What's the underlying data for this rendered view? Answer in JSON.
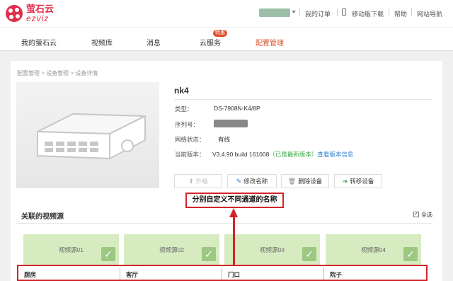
{
  "brand": {
    "name": "萤石云",
    "sub": "ezviz",
    "color": "#e02e4c"
  },
  "topnav": {
    "orders": "我的订单",
    "mobile": "移动版下载",
    "help": "帮助",
    "sitemap": "网站导航"
  },
  "nav": {
    "items": [
      "我的萤石云",
      "视频库",
      "消息",
      "云服务",
      "配置管理"
    ],
    "active_index": 4,
    "badge": "特惠"
  },
  "breadcrumb": "配置管理 > 设备管理 > 设备详情",
  "device": {
    "name": "nk4",
    "type_label": "类型：",
    "type_value": "DS-7908N-K4/8P",
    "serial_label": "序列号：",
    "network_label": "网络状态：",
    "network_value": "有线",
    "version_label": "当前版本：",
    "version_value": "V3.4.90 build 161008",
    "version_status": "（已是最新版本）",
    "version_link": "查看版本信息"
  },
  "buttons": {
    "upgrade": "升级",
    "rename": "修改名称",
    "delete": "删除设备",
    "transfer": "转移设备"
  },
  "section": {
    "title": "关联的视频源",
    "select_all": "全选"
  },
  "channels": [
    "视频源01",
    "视频源02",
    "视频源03",
    "视频源04"
  ],
  "channel_names": [
    "厨房",
    "客厅",
    "门口",
    "院子"
  ],
  "annotation": "分别自定义不同通道的名称",
  "colors": {
    "accent": "#e0502c",
    "annotation_red": "#d3232a",
    "channel_bg": "#d6ecc0",
    "check_green": "#9cc882",
    "link": "#2d7fd0",
    "ok_green": "#3aa845"
  }
}
